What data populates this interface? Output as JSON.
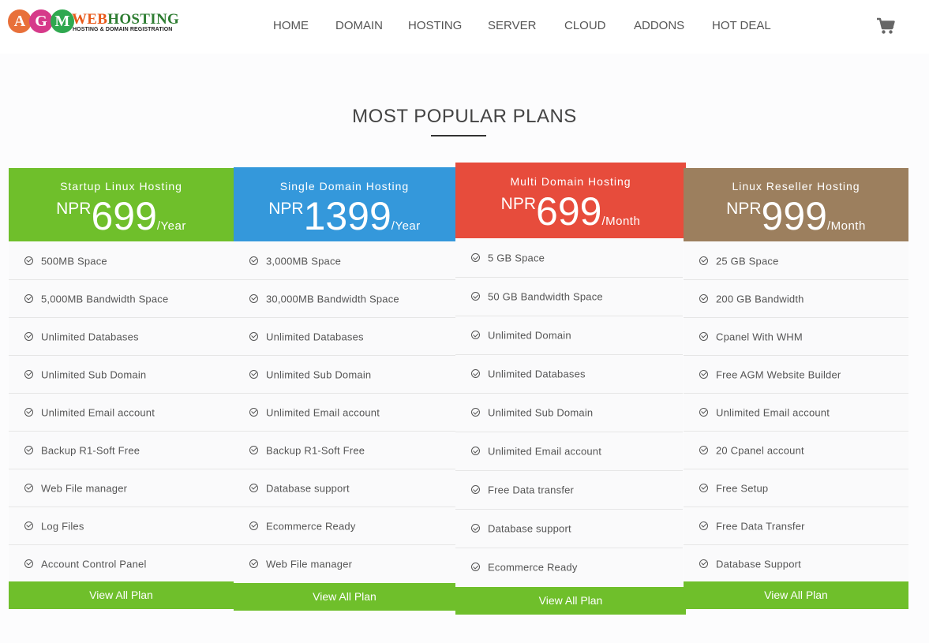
{
  "header": {
    "logo": {
      "letters": [
        "A",
        "G",
        "M"
      ],
      "brand_web": "WEB",
      "brand_hosting": "HOSTING",
      "tagline": "HOSTING & DOMAIN REGISTRATION"
    },
    "nav": [
      "HOME",
      "DOMAIN",
      "HOSTING",
      "SERVER",
      "CLOUD",
      "ADDONS",
      "HOT DEAL"
    ],
    "cart_icon": "shopping-cart-icon"
  },
  "section": {
    "title": "MOST POPULAR PLANS"
  },
  "plans": [
    {
      "name": "Startup Linux Hosting",
      "currency": "NPR",
      "price": "699",
      "period": "/Year",
      "color": "#6fbf2b",
      "features": [
        "500MB Space",
        "5,000MB Bandwidth Space",
        "Unlimited Databases",
        "Unlimited Sub Domain",
        "Unlimited Email account",
        "Backup R1-Soft Free",
        "Web File manager",
        "Log Files",
        "Account Control Panel"
      ],
      "button": "View All Plan"
    },
    {
      "name": "Single Domain Hosting",
      "currency": "NPR",
      "price": "1399",
      "period": "/Year",
      "color": "#3498db",
      "features": [
        "3,000MB Space",
        "30,000MB Bandwidth Space",
        "Unlimited Databases",
        "Unlimited Sub Domain",
        "Unlimited Email account",
        "Backup R1-Soft Free",
        "Database support",
        "Ecommerce Ready",
        "Web File manager"
      ],
      "button": "View All Plan"
    },
    {
      "name": "Multi Domain Hosting",
      "currency": "NPR",
      "price": "699",
      "period": "/Month",
      "color": "#e74c3c",
      "features": [
        "5 GB Space",
        "50 GB Bandwidth Space",
        "Unlimited Domain",
        "Unlimited Databases",
        "Unlimited Sub Domain",
        "Unlimited Email account",
        "Free Data transfer",
        "Database support",
        "Ecommerce Ready"
      ],
      "button": "View All Plan"
    },
    {
      "name": "Linux Reseller Hosting",
      "currency": "NPR",
      "price": "999",
      "period": "/Month",
      "color": "#9c7f5e",
      "features": [
        "25 GB Space",
        "200 GB Bandwidth",
        "Cpanel With WHM",
        "Free AGM Website Builder",
        "Unlimited Email account",
        "20 Cpanel account",
        "Free Setup",
        "Free Data Transfer",
        "Database Support"
      ],
      "button": "View All Plan"
    }
  ]
}
